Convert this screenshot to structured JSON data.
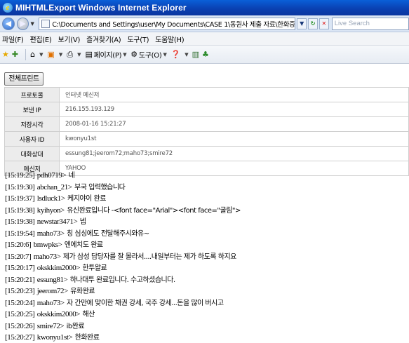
{
  "window": {
    "title": "MIHTMLExport   Windows Internet Explorer"
  },
  "addressbar": {
    "url": "C:\\Documents and Settings\\user\\My Documents\\CASE 1\\동원사 제출 자료\\한화증권\\한화증권권인",
    "search_placeholder": "Live Search"
  },
  "menu": {
    "items": [
      "파일(F)",
      "편집(E)",
      "보기(V)",
      "즐겨찾기(A)",
      "도구(T)",
      "도움말(H)"
    ]
  },
  "toolbar": {
    "page_label": "페이지(P)",
    "tools_label": "도구(O)"
  },
  "content": {
    "print_button": "전체프린트",
    "info": [
      {
        "key": "프로토콜",
        "value": "인터넷 메신저"
      },
      {
        "key": "보낸 IP",
        "value": "216.155.193.129"
      },
      {
        "key": "저장시각",
        "value": "2008-01-16 15:21:27"
      },
      {
        "key": "사용자 ID",
        "value": "kwonyu1st"
      },
      {
        "key": "대화상대",
        "value": "essung81;jeerom72;maho73;smire72"
      },
      {
        "key": "메신저",
        "value": "YAHOO"
      }
    ],
    "chat": [
      {
        "ts": "[15:19:25]",
        "user": "pdh0719>",
        "msg": "네"
      },
      {
        "ts": "[15:19:30]",
        "user": "abchan_21>",
        "msg": "부국 입력했습니다"
      },
      {
        "ts": "[15:19:37]",
        "user": "lsdluck1>",
        "msg": "케지야이 완료"
      },
      {
        "ts": "[15:19:38]",
        "user": "kyihyon>",
        "msg": "유신완료입니다 -<font face=\"Arial\"><font face=\"굴림\">"
      },
      {
        "ts": "[15:19:38]",
        "user": "newstar3471>",
        "msg": "넵"
      },
      {
        "ts": "[15:19:54]",
        "user": "maho73>",
        "msg": "칭 심싱에도 전달해주시와유~"
      },
      {
        "ts": "[15:20:6]",
        "user": "bmwpks>",
        "msg": "엔에치도 완료"
      },
      {
        "ts": "[15:20:7]",
        "user": "maho73>",
        "msg": "제가 삼성 담당자를 잘 몰라서....내일부터는 제가 하도록 하지요"
      },
      {
        "ts": "[15:20:17]",
        "user": "okskkim2000>",
        "msg": "한투왈료"
      },
      {
        "ts": "[15:20:21]",
        "user": "essung81>",
        "msg": "하나대투 완료입니다. 수고하셨습니다."
      },
      {
        "ts": "[15:20:23]",
        "user": "jeerom72>",
        "msg": "유화완료"
      },
      {
        "ts": "[15:20:24]",
        "user": "maho73>",
        "msg": "자 간만에 맞이한 채권 강세, 국주 강세...돈을 많이 버시고"
      },
      {
        "ts": "[15:20:25]",
        "user": "okskkim2000>",
        "msg": "해산"
      },
      {
        "ts": "[15:20:26]",
        "user": "smire72>",
        "msg": "ib완료"
      },
      {
        "ts": "[15:20:27]",
        "user": "kwonyu1st>",
        "msg": "한화완료"
      }
    ]
  },
  "colors": {
    "titlebar": "#0a4fc8",
    "chrome": "#dbe6f5"
  },
  "icons": [
    "ie-icon",
    "back-arrow-icon",
    "forward-arrow-icon",
    "page-icon",
    "refresh-icon",
    "stop-icon",
    "star-icon",
    "add-favorite-icon",
    "home-icon",
    "feeds-icon",
    "print-icon",
    "page-icon",
    "tools-gear-icon",
    "help-icon",
    "research-icon",
    "messenger-icon"
  ]
}
